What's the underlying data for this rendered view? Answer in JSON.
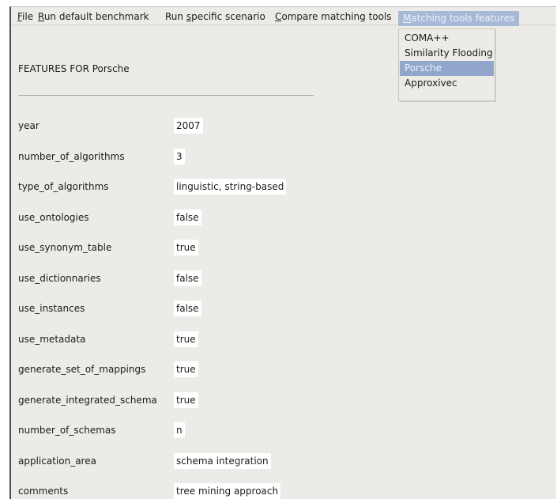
{
  "menubar": {
    "file": {
      "mnemonic": "F",
      "rest": "ile"
    },
    "run_default": {
      "mnemonic": "R",
      "rest": "un default benchmark"
    },
    "run_specific_a": "Run ",
    "run_specific_mn": "s",
    "run_specific_b": "pecific scenario",
    "compare_mn": "C",
    "compare_rest": "ompare matching tools",
    "features_mn": "M",
    "features_rest": "atching tools features"
  },
  "dropdown": {
    "items": [
      "COMA++",
      "Similarity Flooding",
      "Porsche",
      "Approxivec"
    ],
    "selected": "Porsche"
  },
  "panel": {
    "title": "FEATURES FOR Porsche",
    "rows": [
      {
        "label": "year",
        "value": "2007"
      },
      {
        "label": "number_of_algorithms",
        "value": "3"
      },
      {
        "label": "type_of_algorithms",
        "value": "linguistic, string-based"
      },
      {
        "label": "use_ontologies",
        "value": "false"
      },
      {
        "label": "use_synonym_table",
        "value": "true"
      },
      {
        "label": "use_dictionnaries",
        "value": "false"
      },
      {
        "label": "use_instances",
        "value": "false"
      },
      {
        "label": "use_metadata",
        "value": "true"
      },
      {
        "label": "generate_set_of_mappings",
        "value": "true"
      },
      {
        "label": "generate_integrated_schema",
        "value": "true"
      },
      {
        "label": "number_of_schemas",
        "value": "n"
      },
      {
        "label": "application_area",
        "value": "schema integration"
      },
      {
        "label": "comments",
        "value": "tree mining approach"
      }
    ]
  }
}
